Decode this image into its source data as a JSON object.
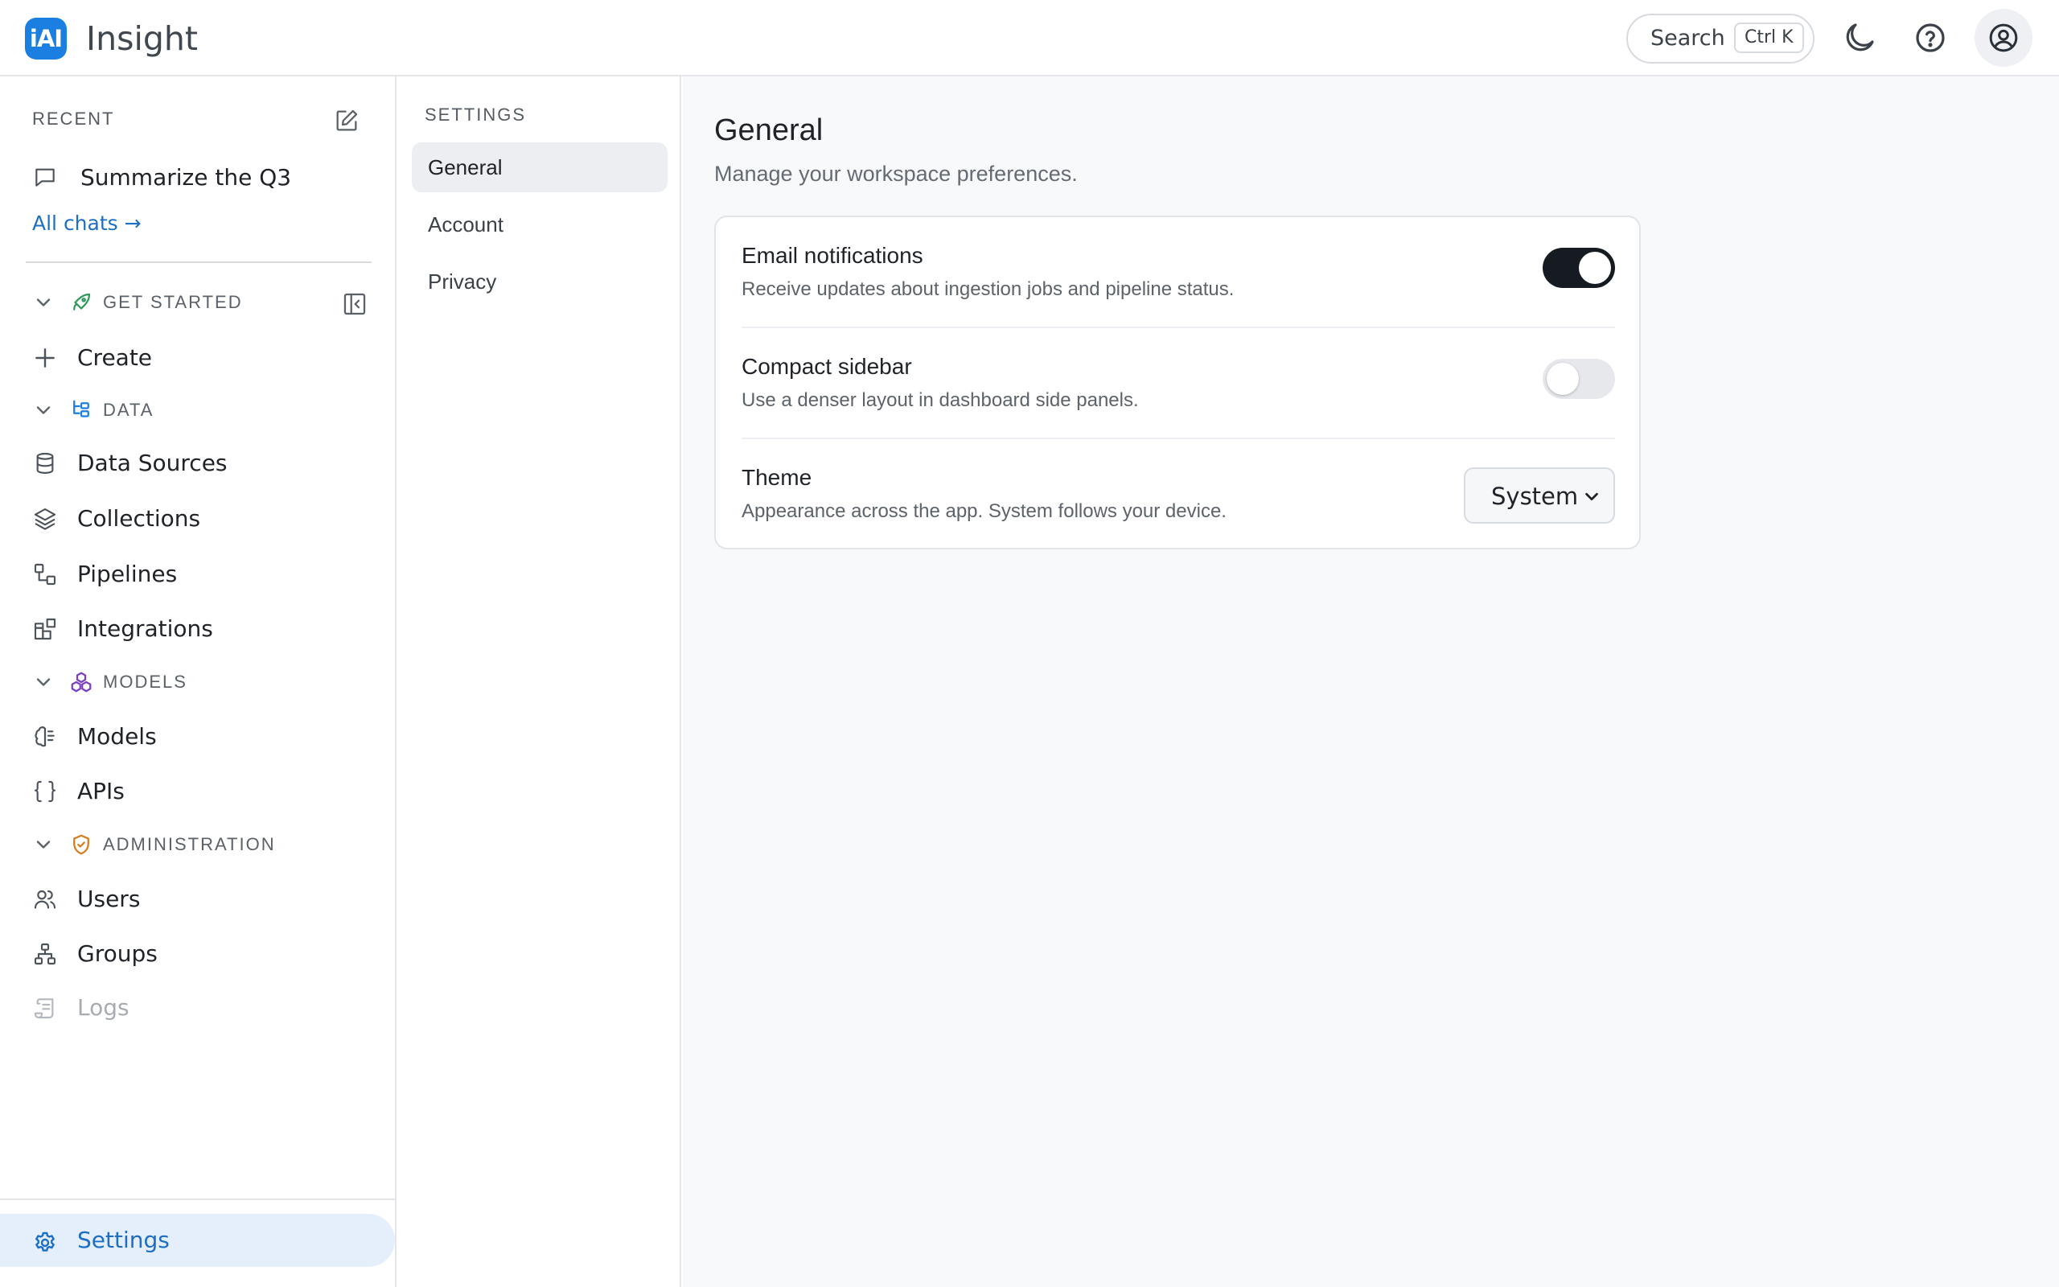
{
  "header": {
    "logo_text": "iAI",
    "app_title": "Insight",
    "search_label": "Search",
    "search_shortcut": "Ctrl K",
    "icons": [
      "moon-icon",
      "help-circle-icon",
      "user-circle-icon"
    ]
  },
  "sidebar": {
    "recent_header": "RECENT",
    "recent_items": [
      "Summarize the Q3"
    ],
    "all_chats": "All chats →",
    "sections": {
      "get_started": "GET STARTED",
      "data": "DATA",
      "models": "MODELS",
      "administration": "ADMINISTRATION"
    },
    "items": {
      "create": "Create",
      "data_sources": "Data Sources",
      "collections": "Collections",
      "pipelines": "Pipelines",
      "integrations": "Integrations",
      "models": "Models",
      "apis": "APIs",
      "users": "Users",
      "groups": "Groups",
      "logs": "Logs"
    },
    "settings": "Settings"
  },
  "settings_nav": {
    "header": "SETTINGS",
    "items": [
      "General",
      "Account",
      "Privacy"
    ],
    "active": "General"
  },
  "main": {
    "title": "General",
    "subtitle": "Manage your workspace preferences.",
    "rows": [
      {
        "title": "Email notifications",
        "description": "Receive updates about ingestion jobs and pipeline status.",
        "control": "toggle",
        "on": true
      },
      {
        "title": "Compact sidebar",
        "description": "Use a denser layout in dashboard side panels.",
        "control": "toggle",
        "on": false
      },
      {
        "title": "Theme",
        "description": "Appearance across the app. System follows your device.",
        "control": "select",
        "value": "System"
      }
    ]
  },
  "colors": {
    "accent": "#1a7fe0",
    "link": "#1c6fc4",
    "active_bg": "#e5eefb",
    "toggle_on": "#161b22",
    "rocket_icon": "#2e9a5a",
    "models_icon": "#7a3fc2",
    "admin_icon": "#d97a1a"
  }
}
